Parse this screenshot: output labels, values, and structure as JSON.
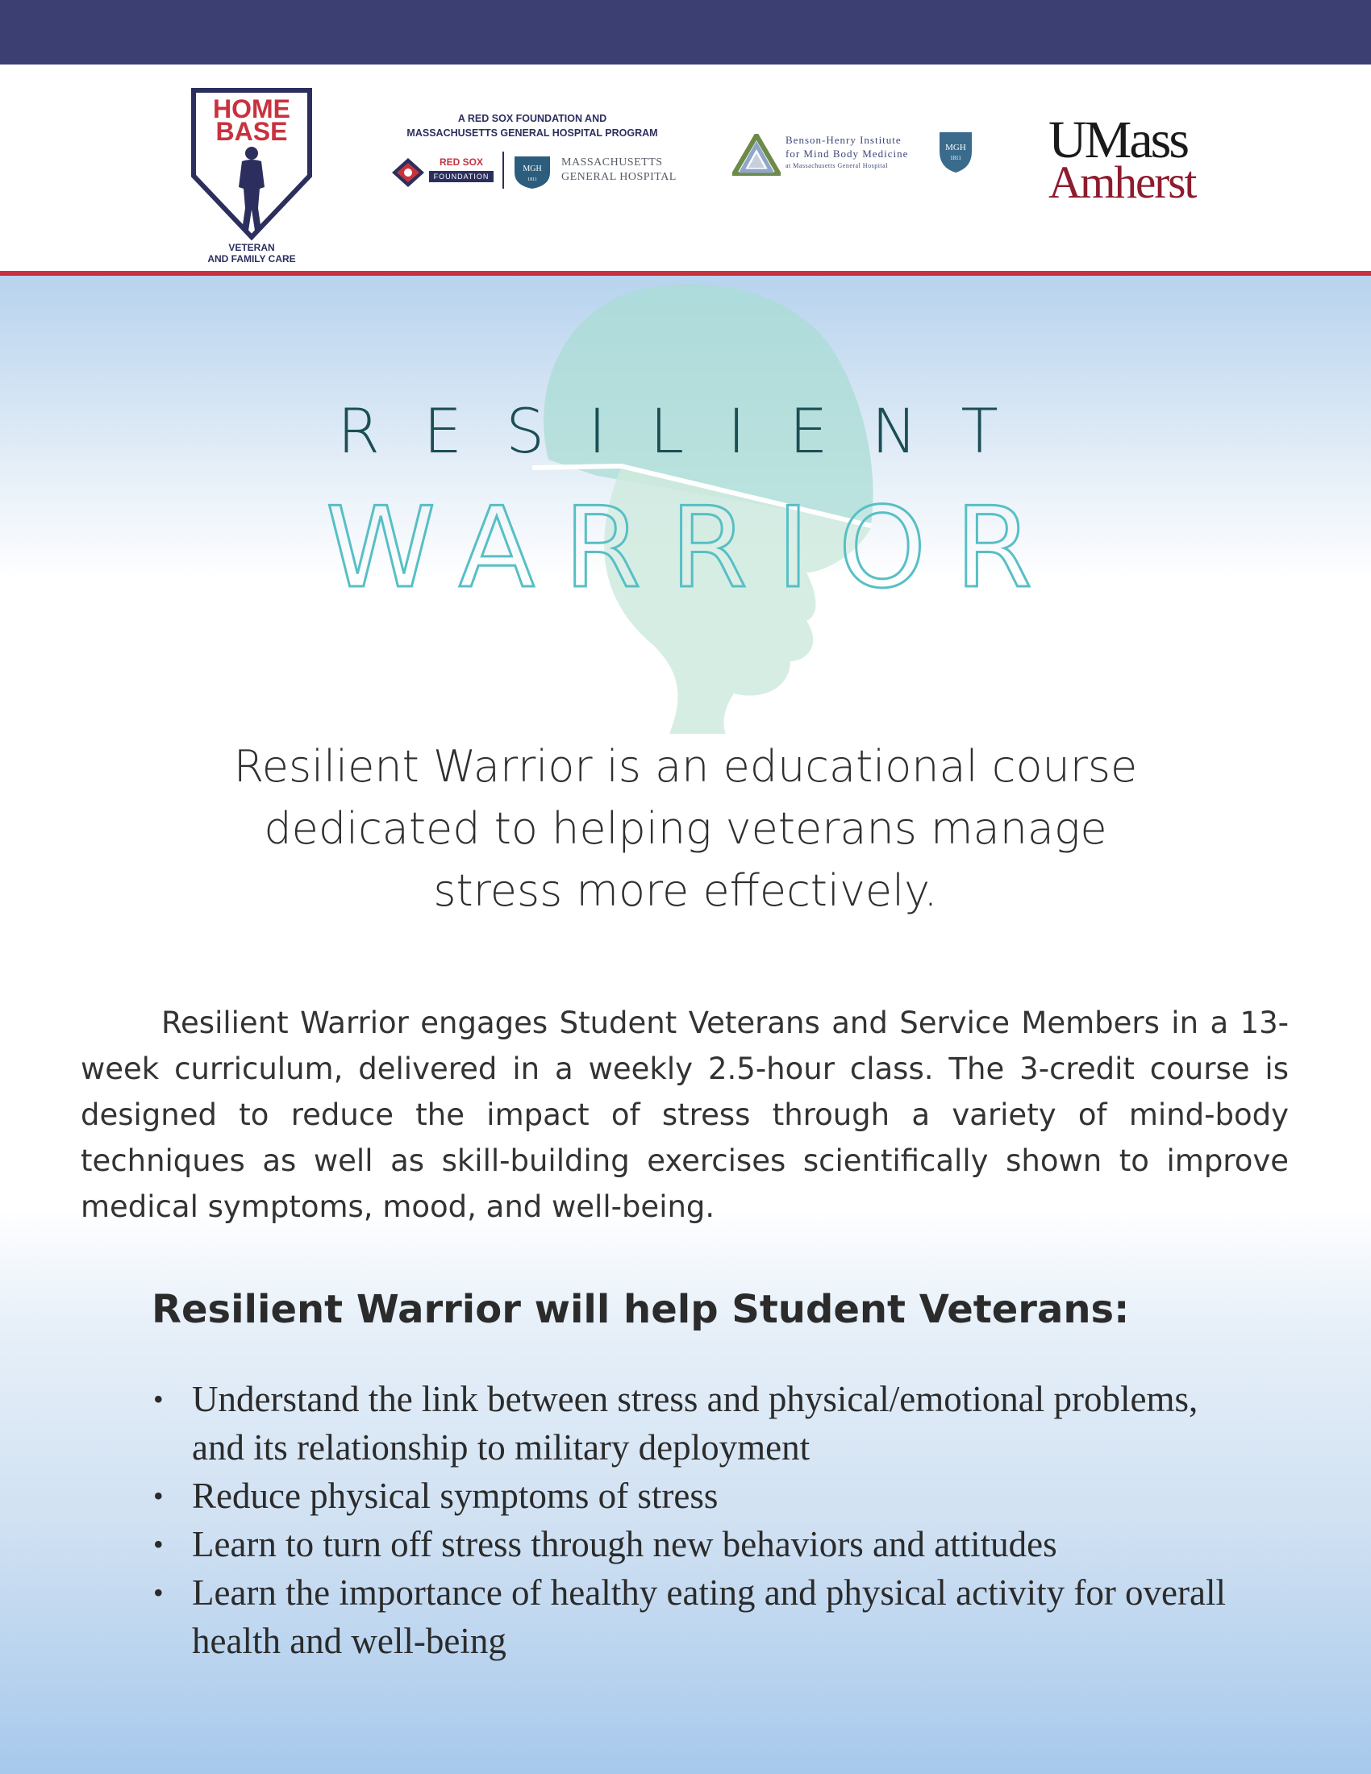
{
  "header": {
    "home_base": {
      "word1": "HOME",
      "word2": "BASE",
      "tagline1": "VETERAN",
      "tagline2": "AND FAMILY CARE"
    },
    "red_sox": {
      "line1": "A RED SOX FOUNDATION AND",
      "line2": "MASSACHUSETTS GENERAL HOSPITAL PROGRAM",
      "red_sox_word": "RED SOX",
      "foundation_word": "FOUNDATION",
      "mgh_line1": "MASSACHUSETTS",
      "mgh_line2": "GENERAL HOSPITAL",
      "shield_text": "MGH",
      "shield_year": "1811"
    },
    "benson_henry": {
      "line1": "Benson-Henry Institute",
      "line2": "for Mind Body Medicine",
      "line3": "at Massachusetts General Hospital",
      "shield_text": "MGH",
      "shield_year": "1811"
    },
    "umass": {
      "line1": "UMass",
      "line2": "Amherst"
    }
  },
  "title": {
    "line1": "RESILIENT",
    "line2": "WARRIOR"
  },
  "lead": {
    "line1": "Resilient Warrior is an educational course",
    "line2": "dedicated to helping veterans manage",
    "line3": "stress more effectively."
  },
  "body": "Resilient Warrior engages Student Veterans and Service Members in a 13-week curriculum, delivered in a weekly 2.5-hour class. The 3-credit course is designed to reduce the impact of stress through a variety of mind-body techniques as well as skill-building exercises scientifically shown to improve medical symptoms, mood, and well-being.",
  "help": {
    "heading": "Resilient Warrior will help Student Veterans:",
    "bullet": "•",
    "items": [
      "Understand the link between stress and physical/emotional problems, and its relationship to military deployment",
      "Reduce physical symptoms of stress",
      "Learn to turn off stress through new behaviors and attitudes",
      "Learn the importance of healthy eating and physical activity for overall health and well-being"
    ]
  },
  "colors": {
    "top_bar": "#3c3f72",
    "rule": "#c8323f",
    "title_dark": "#1b4e55",
    "title_teal": "#57bfc5",
    "umass_red": "#8e1c2e"
  }
}
